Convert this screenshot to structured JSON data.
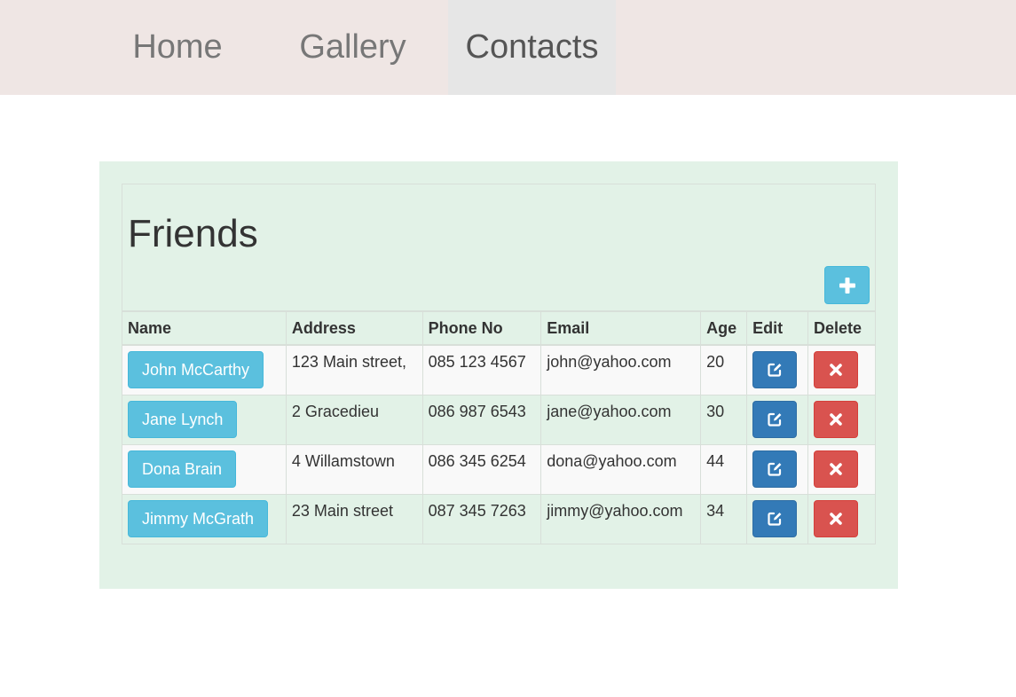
{
  "nav": {
    "items": [
      {
        "label": "Home",
        "active": false
      },
      {
        "label": "Gallery",
        "active": false
      },
      {
        "label": "Contacts",
        "active": true
      }
    ]
  },
  "friends": {
    "title": "Friends",
    "add_icon": "plus-icon",
    "columns": [
      "Name",
      "Address",
      "Phone No",
      "Email",
      "Age",
      "Edit",
      "Delete"
    ],
    "rows": [
      {
        "name": "John McCarthy",
        "address": "123 Main street,",
        "phone": "085 123 4567",
        "email": "john@yahoo.com",
        "age": "20"
      },
      {
        "name": "Jane Lynch",
        "address": "2 Gracedieu",
        "phone": "086 987 6543",
        "email": "jane@yahoo.com",
        "age": "30"
      },
      {
        "name": "Dona Brain",
        "address": "4 Willamstown",
        "phone": "086 345 6254",
        "email": "dona@yahoo.com",
        "age": "44"
      },
      {
        "name": "Jimmy McGrath",
        "address": "23 Main street",
        "phone": "087 345 7263",
        "email": "jimmy@yahoo.com",
        "age": "34"
      }
    ],
    "edit_icon": "edit-icon",
    "delete_icon": "close-icon"
  },
  "colors": {
    "nav_bg": "#efe6e4",
    "nav_active_bg": "#e6e6e6",
    "container_bg": "#e2f2e7",
    "info": "#5bc0de",
    "primary": "#337ab7",
    "danger": "#d9534f"
  }
}
